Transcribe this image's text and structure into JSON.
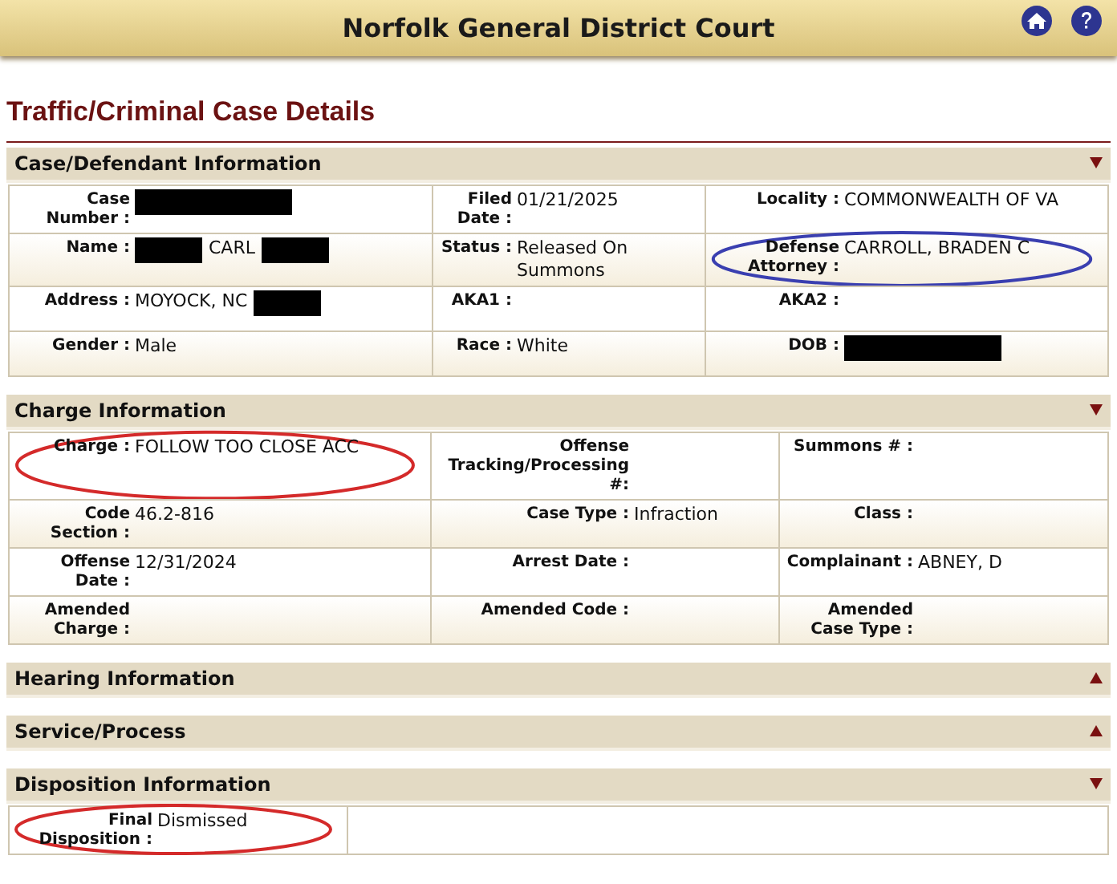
{
  "header": {
    "title": "Norfolk General District Court"
  },
  "page_title": "Traffic/Criminal Case Details",
  "sections": [
    {
      "title": "Case/Defendant Information",
      "expanded": true,
      "rows": [
        [
          {
            "label": "Case Number :",
            "value": [
              {
                "kind": "redacted"
              }
            ]
          },
          {
            "label": "Filed Date :",
            "value": [
              {
                "kind": "text",
                "text": "01/21/2025"
              }
            ]
          },
          {
            "label": "Locality :",
            "value": [
              {
                "kind": "text",
                "text": "COMMONWEALTH OF VA"
              }
            ]
          }
        ],
        [
          {
            "label": "Name :",
            "value": [
              {
                "kind": "redacted"
              },
              {
                "kind": "text",
                "text": "CARL"
              },
              {
                "kind": "redacted"
              }
            ]
          },
          {
            "label": "Status :",
            "value": [
              {
                "kind": "text",
                "text": "Released On Summons"
              }
            ]
          },
          {
            "label": "Defense Attorney :",
            "value": [
              {
                "kind": "text",
                "text": "CARROLL, BRADEN C"
              }
            ],
            "circle": {
              "color": "#3a3fb0"
            }
          }
        ],
        [
          {
            "label": "Address :",
            "value": [
              {
                "kind": "text",
                "text": "MOYOCK, NC"
              },
              {
                "kind": "redacted"
              }
            ]
          },
          {
            "label": "AKA1 :"
          },
          {
            "label": "AKA2 :"
          }
        ],
        [
          {
            "label": "Gender :",
            "value": [
              {
                "kind": "text",
                "text": "Male"
              }
            ]
          },
          {
            "label": "Race :",
            "value": [
              {
                "kind": "text",
                "text": "White"
              }
            ]
          },
          {
            "label": "DOB :",
            "value": [
              {
                "kind": "redacted"
              }
            ]
          }
        ]
      ]
    },
    {
      "title": "Charge Information",
      "expanded": true,
      "rows": [
        [
          {
            "label": "Charge :",
            "value": [
              {
                "kind": "text",
                "text": "FOLLOW TOO CLOSE ACC"
              }
            ],
            "circle": {
              "color": "#d42a2a"
            }
          },
          {
            "label": "Offense Tracking/Processing #:"
          },
          {
            "label": "Summons # :"
          }
        ],
        [
          {
            "label": "Code Section :",
            "value": [
              {
                "kind": "text",
                "text": "46.2-816"
              }
            ]
          },
          {
            "label": "Case Type :",
            "value": [
              {
                "kind": "text",
                "text": "Infraction"
              }
            ]
          },
          {
            "label": "Class :"
          }
        ],
        [
          {
            "label": "Offense Date :",
            "value": [
              {
                "kind": "text",
                "text": "12/31/2024"
              }
            ]
          },
          {
            "label": "Arrest Date :"
          },
          {
            "label": "Complainant :",
            "value": [
              {
                "kind": "text",
                "text": "ABNEY, D"
              }
            ]
          }
        ],
        [
          {
            "label": "Amended Charge :"
          },
          {
            "label": "Amended Code :"
          },
          {
            "label": "Amended Case Type :"
          }
        ]
      ]
    },
    {
      "title": "Hearing Information",
      "expanded": false
    },
    {
      "title": "Service/Process",
      "expanded": false
    },
    {
      "title": "Disposition Information",
      "expanded": true,
      "rows": [
        [
          {
            "label": "Final Disposition :",
            "value": [
              {
                "kind": "text",
                "text": "Dismissed"
              }
            ],
            "circle": {
              "color": "#d42a2a"
            }
          }
        ]
      ]
    }
  ]
}
